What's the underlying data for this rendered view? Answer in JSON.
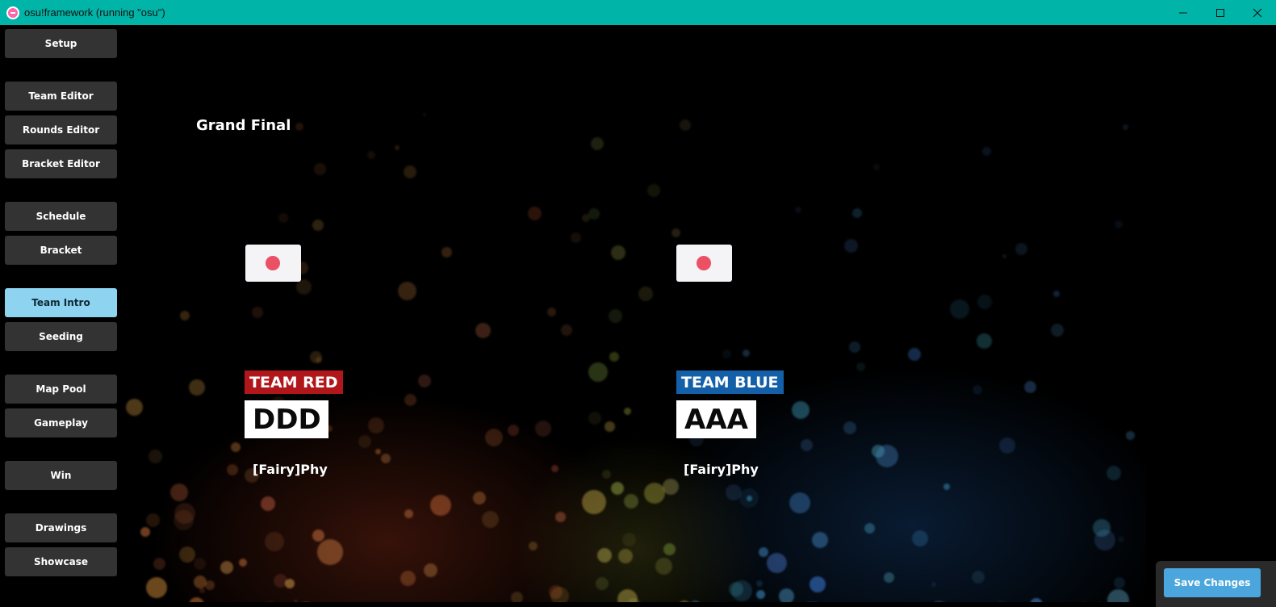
{
  "window": {
    "title": "osu!framework (running \"osu\")",
    "controls": [
      "minimize-icon",
      "maximize-icon",
      "close-icon"
    ],
    "accent_color": "#00b5a8"
  },
  "sidebar": {
    "items": [
      {
        "label": "Setup",
        "active": false
      },
      {
        "label": "Team Editor",
        "active": false
      },
      {
        "label": "Rounds Editor",
        "active": false
      },
      {
        "label": "Bracket Editor",
        "active": false
      },
      {
        "label": "Schedule",
        "active": false
      },
      {
        "label": "Bracket",
        "active": false
      },
      {
        "label": "Team Intro",
        "active": true
      },
      {
        "label": "Seeding",
        "active": false
      },
      {
        "label": "Map Pool",
        "active": false
      },
      {
        "label": "Gameplay",
        "active": false
      },
      {
        "label": "Win",
        "active": false
      },
      {
        "label": "Drawings",
        "active": false
      },
      {
        "label": "Showcase",
        "active": false
      }
    ],
    "active_color": "#8ed3ef"
  },
  "main": {
    "round_name": "Grand Final",
    "team_red": {
      "label": "TEAM RED",
      "acronym": "DDD",
      "player": "[Fairy]Phy",
      "flag": "japan-flag-icon",
      "color": "#b1161a"
    },
    "team_blue": {
      "label": "TEAM BLUE",
      "acronym": "AAA",
      "player": "[Fairy]Phy",
      "flag": "japan-flag-icon",
      "color": "#1460a8"
    }
  },
  "footer": {
    "save_label": "Save Changes",
    "save_color": "#4aa6dc"
  }
}
